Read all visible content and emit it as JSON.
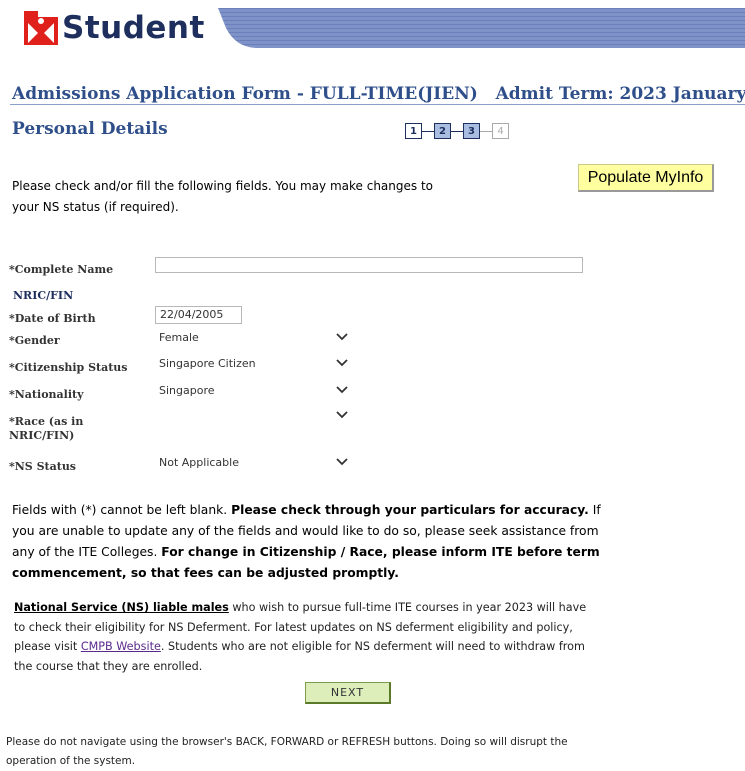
{
  "logo": {
    "text": "Student"
  },
  "form": {
    "title": "Admissions Application Form - FULL-TIME(JIEN)",
    "admit_term": "Admit Term: 2023 January",
    "section": "Personal Details"
  },
  "steps": [
    "1",
    "2",
    "3",
    "4"
  ],
  "myinfo_button": "Populate MyInfo",
  "intro": "Please check and/or fill the following fields. You may make changes to your NS status (if required).",
  "fields": {
    "name_label": "*Complete Name",
    "name_value": "",
    "nric_label": "NRIC/FIN",
    "dob_label": "*Date of Birth",
    "dob_value": "22/04/2005",
    "gender_label": "*Gender",
    "gender_value": "Female",
    "citizenship_label": "*Citizenship Status",
    "citizenship_value": "Singapore Citizen",
    "nationality_label": "*Nationality",
    "nationality_value": "Singapore",
    "race_label_1": "*Race (as in",
    "race_label_2": "NRIC/FIN)",
    "race_value": "",
    "ns_label": "*NS Status",
    "ns_value": "Not Applicable"
  },
  "notes": {
    "blank_prefix": "Fields with (*) cannot be left blank. ",
    "accuracy": "Please check through your particulars for accuracy.",
    "assist": " If you are unable to update any of the fields and would like to do so, please seek assistance from any of the ITE Colleges. ",
    "change": "For change in Citizenship / Race, please inform ITE before term commencement, so that fees can be adjusted promptly."
  },
  "ns": {
    "liable": "National Service (NS) liable males",
    "text1": " who wish to pursue full-time ITE courses in year 2023 will have to check their eligibility for NS Deferment. For latest updates on NS deferment eligibility and policy, please visit ",
    "link": "CMPB Website",
    "text2": ". Students who are not eligible for NS deferment will need to withdraw from the course that they are enrolled."
  },
  "next_button": "Next",
  "footer": "Please do not navigate using the browser's BACK, FORWARD or REFRESH buttons. Doing so will disrupt the operation of the system.",
  "colors": {
    "brand": "#1e2f5e",
    "accent_red": "#e0201a",
    "heading": "#2f4f8a",
    "myinfo_bg": "#ffffa0",
    "next_bg": "#ddeebb"
  }
}
